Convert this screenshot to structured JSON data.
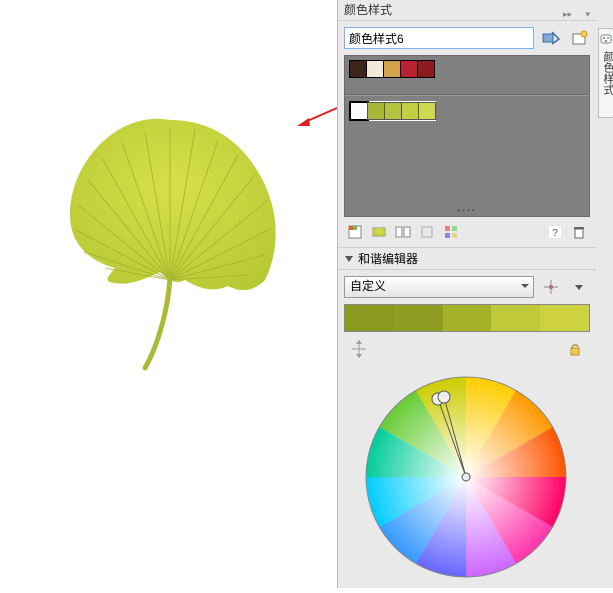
{
  "panel_title": "颜色样式",
  "style_name": "颜色样式6",
  "swatch_row1": [
    "#3d2418",
    "#f2ead8",
    "#d4a24a",
    "#b8232f",
    "#8c1a1f"
  ],
  "swatch_row2": [
    "#fdfdfd",
    "#a7b838",
    "#b3c23f",
    "#c2cf42",
    "#d0d94f"
  ],
  "harmony_title": "和谐编辑器",
  "harmony_type": "自定义",
  "harmony_colors": [
    "#8a9a1f",
    "#8f9d23",
    "#a4b22a",
    "#bfc93a",
    "#cdd23e"
  ],
  "side_tab": "颜色样式",
  "chart_data": null
}
